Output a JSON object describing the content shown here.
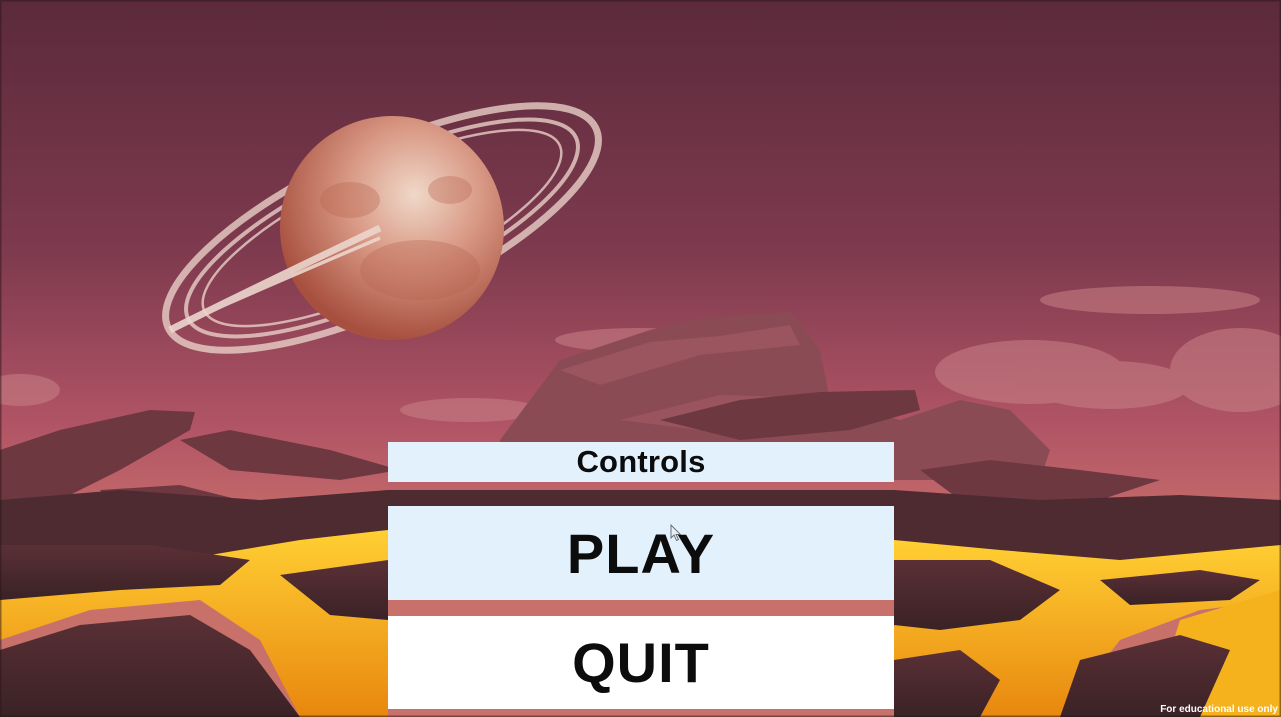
{
  "menu": {
    "controls_label": "Controls",
    "play_label": "PLAY",
    "quit_label": "QUIT"
  },
  "footer": {
    "watermark": "For educational use only"
  },
  "colors": {
    "sky_top": "#5e2c3d",
    "sky_bottom": "#b8566a",
    "lava": "#f2a21a",
    "button_highlight": "#e3f1fc",
    "button_plain": "#ffffff",
    "button_text": "#0c0c0c"
  },
  "icons": {
    "pointer": "mouse-cursor-icon"
  }
}
